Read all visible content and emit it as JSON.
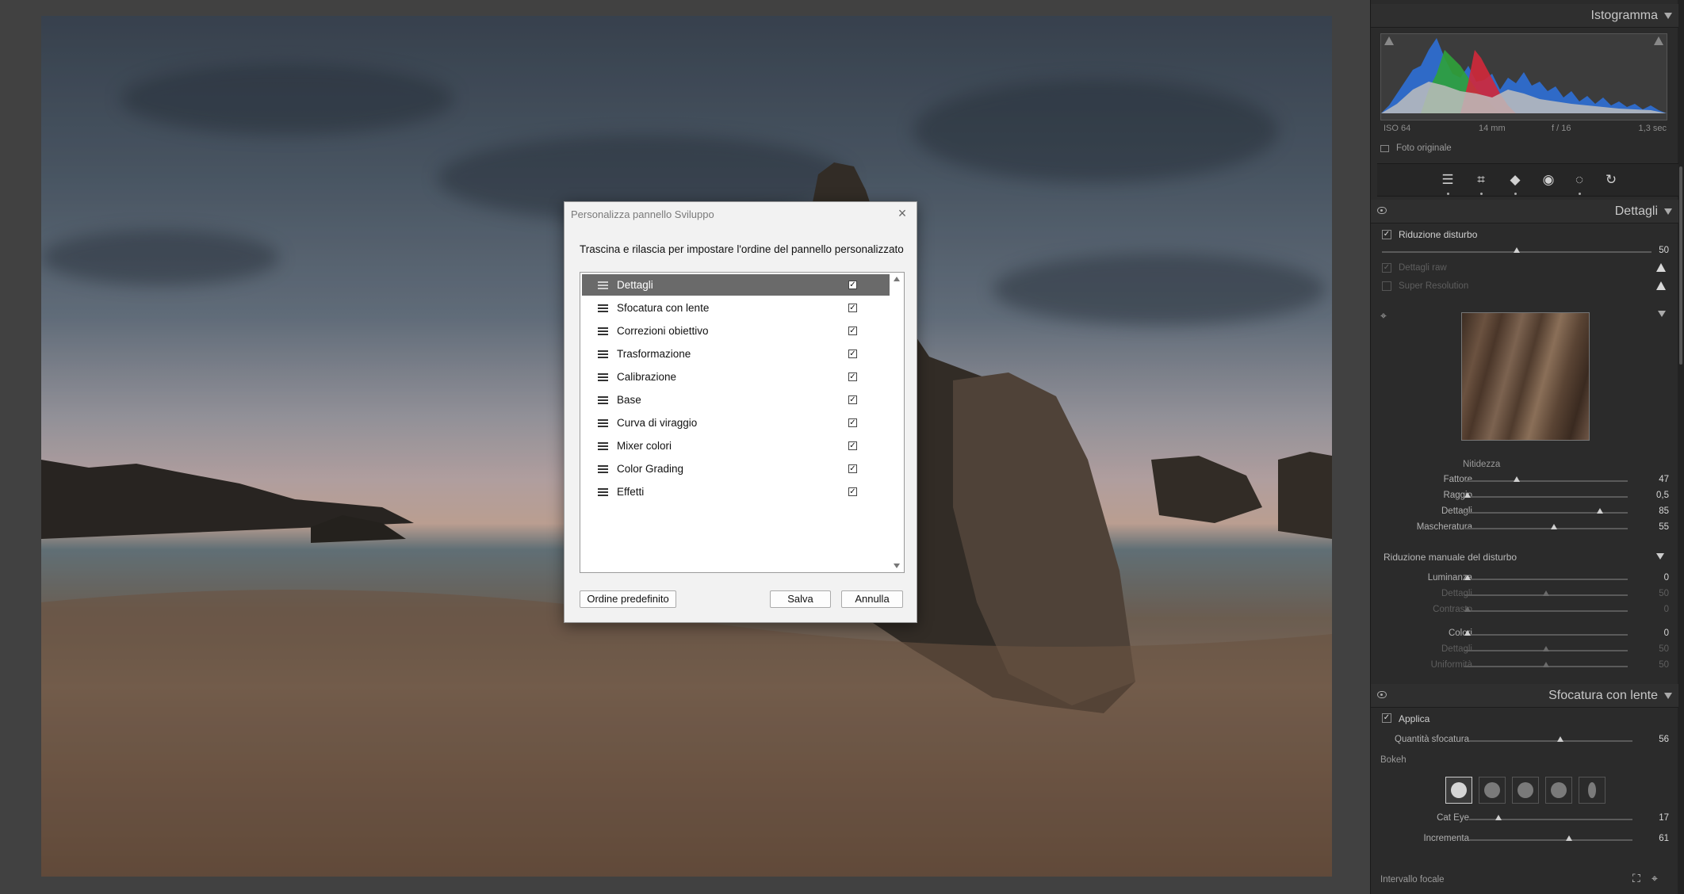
{
  "dialog": {
    "title": "Personalizza pannello Sviluppo",
    "instruction": "Trascina e rilascia per impostare l'ordine del pannello personalizzato",
    "items": [
      {
        "label": "Dettagli",
        "checked": true,
        "selected": true
      },
      {
        "label": "Sfocatura con lente",
        "checked": true
      },
      {
        "label": "Correzioni obiettivo",
        "checked": true
      },
      {
        "label": "Trasformazione",
        "checked": true
      },
      {
        "label": "Calibrazione",
        "checked": true
      },
      {
        "label": "Base",
        "checked": true
      },
      {
        "label": "Curva di viraggio",
        "checked": true
      },
      {
        "label": "Mixer colori",
        "checked": true
      },
      {
        "label": "Color Grading",
        "checked": true
      },
      {
        "label": "Effetti",
        "checked": true
      }
    ],
    "default_order_label": "Ordine predefinito",
    "save_label": "Salva",
    "cancel_label": "Annulla",
    "close_glyph": "×"
  },
  "panel": {
    "histogram": {
      "title": "Istogramma",
      "iso": "ISO 64",
      "focal": "14 mm",
      "aperture": "f / 16",
      "shutter": "1,3 sec",
      "original_photo": "Foto originale"
    },
    "tools": [
      "sliders-icon",
      "crop-icon",
      "eraser-icon",
      "redeye-icon",
      "mask-icon",
      "reset-icon"
    ],
    "details": {
      "title": "Dettagli",
      "noise_reduction": "Riduzione disturbo",
      "noise_value": "50",
      "noise_value_fraction": 0.5,
      "raw_details": "Dettagli raw",
      "super_resolution": "Super Resolution",
      "sharpening_title": "Nitidezza",
      "sharpening": [
        {
          "label": "Fattore",
          "value": "47",
          "pos": 0.32
        },
        {
          "label": "Raggio",
          "value": "0,5",
          "pos": 0.02
        },
        {
          "label": "Dettagli",
          "value": "85",
          "pos": 0.83
        },
        {
          "label": "Mascheratura",
          "value": "55",
          "pos": 0.55
        }
      ],
      "manual_nr_title": "Riduzione manuale del disturbo",
      "manual_nr": [
        {
          "label": "Luminanza",
          "value": "0",
          "pos": 0.02,
          "disabled": false
        },
        {
          "label": "Dettagli",
          "value": "50",
          "pos": 0.5,
          "disabled": true
        },
        {
          "label": "Contrasto",
          "value": "0",
          "pos": 0.02,
          "disabled": true
        },
        {
          "label": "Colori",
          "value": "0",
          "pos": 0.02,
          "disabled": false
        },
        {
          "label": "Dettagli",
          "value": "50",
          "pos": 0.5,
          "disabled": true
        },
        {
          "label": "Uniformità",
          "value": "50",
          "pos": 0.5,
          "disabled": true
        }
      ]
    },
    "lens_blur": {
      "title": "Sfocatura con lente",
      "apply": "Applica",
      "amount_label": "Quantità sfocatura",
      "amount_value": "56",
      "amount_pos": 0.56,
      "bokeh_label": "Bokeh",
      "cat_eye_label": "Cat Eye",
      "cat_eye_value": "17",
      "cat_eye_pos": 0.18,
      "boost_label": "Incrementa",
      "boost_value": "61",
      "boost_pos": 0.61,
      "focal_range_label": "Intervallo focale"
    }
  },
  "colors": {
    "accent": "#6a6a6a",
    "panel_bg": "#2b2b2b",
    "dialog_bg": "#f2f2f2"
  }
}
